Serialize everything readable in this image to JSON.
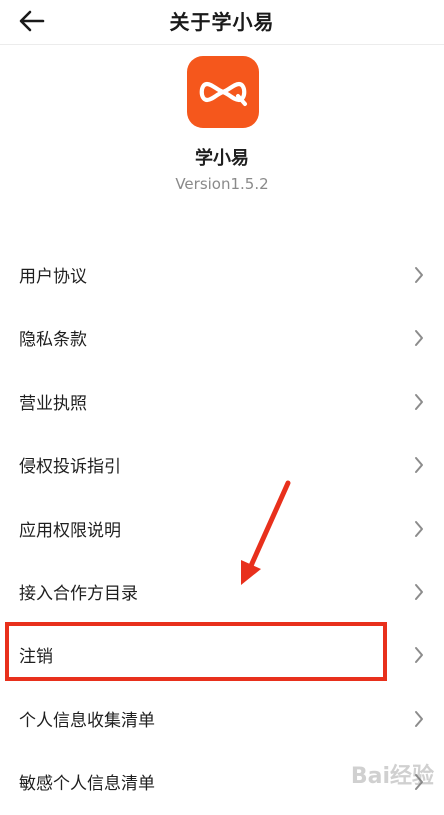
{
  "header": {
    "title": "关于学小易",
    "back_icon": "arrow-left-icon"
  },
  "app": {
    "name": "学小易",
    "version": "Version1.5.2",
    "icon": "infinity-logo-icon",
    "brand_color": "#f5571c"
  },
  "menu": {
    "items": [
      {
        "label": "用户协议"
      },
      {
        "label": "隐私条款"
      },
      {
        "label": "营业执照"
      },
      {
        "label": "侵权投诉指引"
      },
      {
        "label": "应用权限说明"
      },
      {
        "label": "接入合作方目录"
      },
      {
        "label": "注销"
      },
      {
        "label": "个人信息收集清单"
      },
      {
        "label": "敏感个人信息清单"
      }
    ],
    "chevron_icon": "chevron-right-icon"
  },
  "annotation": {
    "highlight_color": "#e8301c",
    "highlighted_item": "注销"
  },
  "watermark": {
    "text": "Bai经验"
  }
}
